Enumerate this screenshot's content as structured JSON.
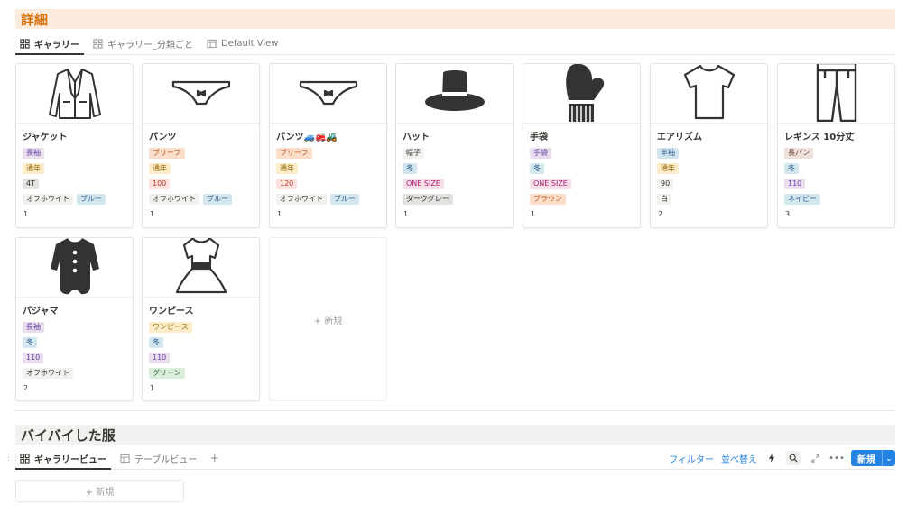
{
  "section1": {
    "title": "詳細",
    "tabs": [
      {
        "label": "ギャラリー",
        "active": true
      },
      {
        "label": "ギャラリー_分類ごと",
        "active": false
      },
      {
        "label": "Default View",
        "active": false
      }
    ],
    "cards": [
      {
        "title": "ジャケット",
        "icon": "jacket-icon",
        "props": [
          [
            {
              "text": "長袖",
              "color": "purple"
            }
          ],
          [
            {
              "text": "通年",
              "color": "yellow"
            }
          ],
          [
            {
              "text": "4T",
              "color": "gray"
            }
          ],
          [
            {
              "text": "オフホワイト",
              "color": "light"
            },
            {
              "text": "ブルー",
              "color": "blue"
            }
          ],
          [
            {
              "text": "1",
              "color": "plain"
            }
          ]
        ]
      },
      {
        "title": "パンツ",
        "icon": "underwear-icon",
        "props": [
          [
            {
              "text": "ブリーフ",
              "color": "orange"
            }
          ],
          [
            {
              "text": "通年",
              "color": "yellow"
            }
          ],
          [
            {
              "text": "100",
              "color": "red"
            }
          ],
          [
            {
              "text": "オフホワイト",
              "color": "light"
            },
            {
              "text": "ブルー",
              "color": "blue"
            }
          ],
          [
            {
              "text": "1",
              "color": "plain"
            }
          ]
        ]
      },
      {
        "title": "パンツ🚙🚒🚜",
        "icon": "underwear-icon",
        "props": [
          [
            {
              "text": "ブリーフ",
              "color": "orange"
            }
          ],
          [
            {
              "text": "通年",
              "color": "yellow"
            }
          ],
          [
            {
              "text": "120",
              "color": "red"
            }
          ],
          [
            {
              "text": "オフホワイト",
              "color": "light"
            },
            {
              "text": "ブルー",
              "color": "blue"
            }
          ],
          [
            {
              "text": "1",
              "color": "plain"
            }
          ]
        ]
      },
      {
        "title": "ハット",
        "icon": "hat-icon",
        "props": [
          [
            {
              "text": "帽子",
              "color": "light"
            }
          ],
          [
            {
              "text": "冬",
              "color": "blue"
            }
          ],
          [
            {
              "text": "ONE SIZE",
              "color": "pink"
            }
          ],
          [
            {
              "text": "ダークグレー",
              "color": "gray"
            }
          ],
          [
            {
              "text": "1",
              "color": "plain"
            }
          ]
        ]
      },
      {
        "title": "手袋",
        "icon": "mitten-icon",
        "props": [
          [
            {
              "text": "手袋",
              "color": "purple"
            }
          ],
          [
            {
              "text": "冬",
              "color": "blue"
            }
          ],
          [
            {
              "text": "ONE SIZE",
              "color": "pink"
            }
          ],
          [
            {
              "text": "ブラウン",
              "color": "orange"
            }
          ],
          [
            {
              "text": "1",
              "color": "plain"
            }
          ]
        ]
      },
      {
        "title": "エアリズム",
        "icon": "tshirt-icon",
        "props": [
          [
            {
              "text": "半袖",
              "color": "blue"
            }
          ],
          [
            {
              "text": "通年",
              "color": "yellow"
            }
          ],
          [
            {
              "text": "90",
              "color": "light"
            }
          ],
          [
            {
              "text": "白",
              "color": "light"
            }
          ],
          [
            {
              "text": "2",
              "color": "plain"
            }
          ]
        ]
      },
      {
        "title": "レギンス 10分丈",
        "icon": "trousers-icon",
        "props": [
          [
            {
              "text": "長パン",
              "color": "brown"
            }
          ],
          [
            {
              "text": "冬",
              "color": "blue"
            }
          ],
          [
            {
              "text": "110",
              "color": "purple"
            }
          ],
          [
            {
              "text": "ネイビー",
              "color": "blue"
            }
          ],
          [
            {
              "text": "3",
              "color": "plain"
            }
          ]
        ]
      },
      {
        "title": "パジャマ",
        "icon": "romper-icon",
        "props": [
          [
            {
              "text": "長袖",
              "color": "purple"
            }
          ],
          [
            {
              "text": "冬",
              "color": "blue"
            }
          ],
          [
            {
              "text": "110",
              "color": "purple"
            }
          ],
          [
            {
              "text": "オフホワイト",
              "color": "light"
            }
          ],
          [
            {
              "text": "2",
              "color": "plain"
            }
          ]
        ]
      },
      {
        "title": "ワンピース",
        "icon": "dress-icon",
        "props": [
          [
            {
              "text": "ワンピース",
              "color": "yellow"
            }
          ],
          [
            {
              "text": "冬",
              "color": "blue"
            }
          ],
          [
            {
              "text": "110",
              "color": "purple"
            }
          ],
          [
            {
              "text": "グリーン",
              "color": "green"
            }
          ],
          [
            {
              "text": "1",
              "color": "plain"
            }
          ]
        ]
      }
    ],
    "new_label": "+ 新規"
  },
  "section2": {
    "title": "バイバイした服",
    "tabs": [
      {
        "label": "ギャラリービュー",
        "active": true
      },
      {
        "label": "テーブルビュー",
        "active": false
      }
    ],
    "add_view": "+",
    "filter_label": "フィルター",
    "sort_label": "並べ替え",
    "new_button_label": "新規",
    "new_label": "+ 新規"
  }
}
